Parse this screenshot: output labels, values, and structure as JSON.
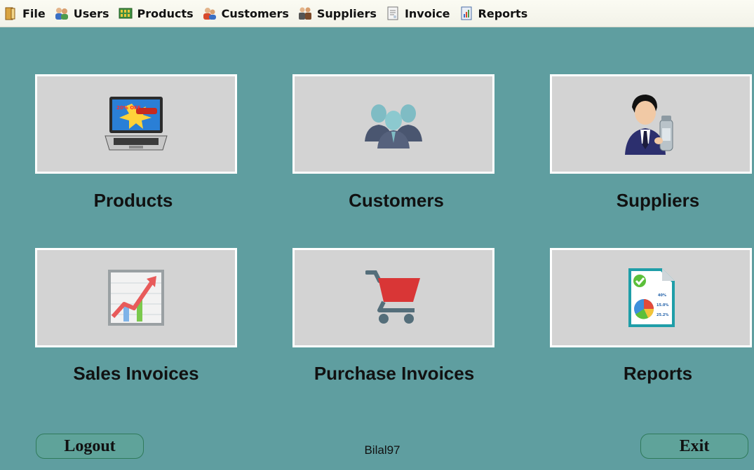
{
  "menu": [
    {
      "label": "File",
      "icon": "file-book-icon"
    },
    {
      "label": "Users",
      "icon": "users-icon"
    },
    {
      "label": "Products",
      "icon": "products-icon"
    },
    {
      "label": "Customers",
      "icon": "customers-icon"
    },
    {
      "label": "Suppliers",
      "icon": "suppliers-icon"
    },
    {
      "label": "Invoice",
      "icon": "invoice-icon"
    },
    {
      "label": "Reports",
      "icon": "reports-icon"
    }
  ],
  "tiles": {
    "products": {
      "label": "Products",
      "icon": "laptop-icon"
    },
    "customers": {
      "label": "Customers",
      "icon": "people-group-icon"
    },
    "suppliers": {
      "label": "Suppliers",
      "icon": "businessman-icon"
    },
    "sales_invoices": {
      "label": "Sales Invoices",
      "icon": "growth-chart-icon"
    },
    "purchase_invoices": {
      "label": "Purchase Invoices",
      "icon": "shopping-cart-icon"
    },
    "reports": {
      "label": "Reports",
      "icon": "report-document-icon"
    }
  },
  "laptop_screen_text": "20% OFF",
  "report_values": [
    "40%",
    "15.0%",
    "25.2%"
  ],
  "footer": {
    "logout_label": "Logout",
    "username": "Bilal97",
    "exit_label": "Exit"
  },
  "colors": {
    "background": "#5f9ea0",
    "tile": "#d3d3d3",
    "tile_border": "#ffffff",
    "cart_red": "#d93636",
    "cart_gray": "#546e7a"
  }
}
